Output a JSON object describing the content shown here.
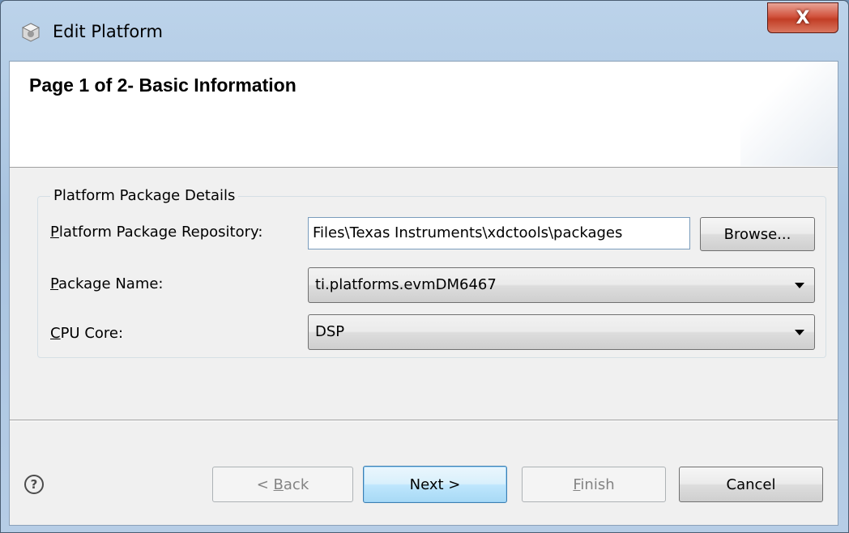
{
  "window": {
    "title": "Edit Platform",
    "close_glyph": "X",
    "app_icon": "gear-box-icon"
  },
  "banner": {
    "title": "Page 1 of 2- Basic Information"
  },
  "group": {
    "legend": "Platform Package Details",
    "repository": {
      "mnemonic": "P",
      "label_rest": "latform Package Repository:",
      "value": "Files\\Texas Instruments\\xdctools\\packages",
      "browse_label": "Browse..."
    },
    "package_name": {
      "mnemonic": "P",
      "label_rest": "ackage Name:",
      "selected": "ti.platforms.evmDM6467"
    },
    "cpu_core": {
      "mnemonic": "C",
      "label_rest": "PU Core:",
      "selected": "DSP"
    }
  },
  "footer": {
    "help_glyph": "?",
    "back": {
      "prefix": "< ",
      "mnemonic": "B",
      "rest": "ack"
    },
    "next_label": "Next >",
    "finish": {
      "mnemonic": "F",
      "rest": "inish"
    },
    "cancel_label": "Cancel"
  },
  "colors": {
    "frame": "#a9c4e0",
    "close_button": "#c23e26",
    "dialog_bg": "#f0f0f0",
    "default_button_border": "#3c7fb1"
  }
}
